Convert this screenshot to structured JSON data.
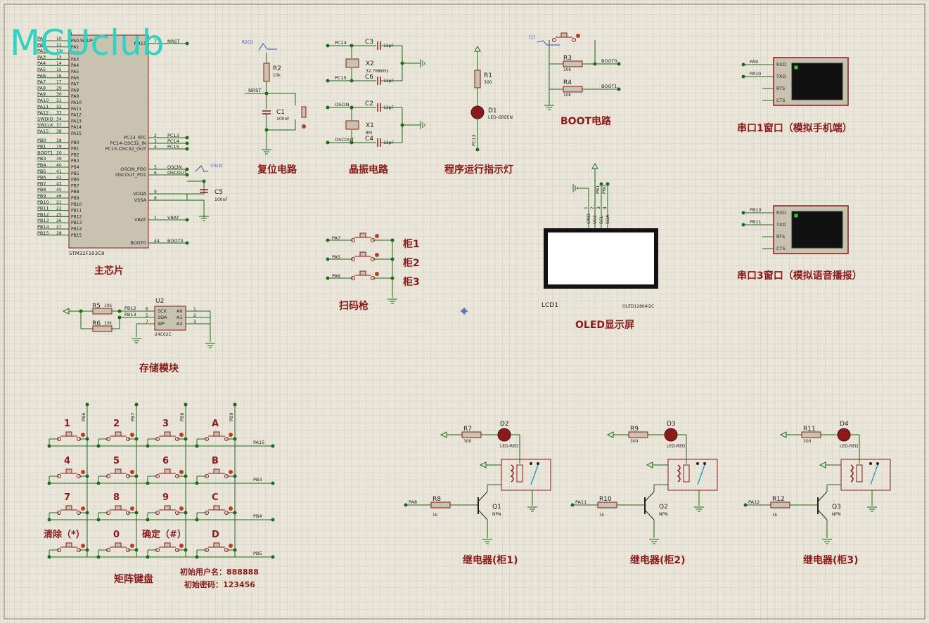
{
  "watermark": "MCUclub",
  "colors": {
    "background": "#e9e6d9",
    "grid": "#d1cdbd",
    "wire": "#1a6b1a",
    "component": "#8b1a1a",
    "chip": "#c8c3b0",
    "label": "#8b1a1a",
    "watermark": "#2ed3c2"
  },
  "mcu": {
    "ref": "U",
    "part": "STM32F103C8",
    "section_label": "主芯片",
    "left_pins": [
      {
        "name": "PA0",
        "num": "10"
      },
      {
        "name": "PA1",
        "num": "11"
      },
      {
        "name": "PA2",
        "num": "12"
      },
      {
        "name": "PA3",
        "num": "13"
      },
      {
        "name": "PA4",
        "num": "14"
      },
      {
        "name": "PA5",
        "num": "15"
      },
      {
        "name": "PA6",
        "num": "16"
      },
      {
        "name": "PA7",
        "num": "17"
      },
      {
        "name": "PA8",
        "num": "29"
      },
      {
        "name": "PA9",
        "num": "30"
      },
      {
        "name": "PA10",
        "num": "31"
      },
      {
        "name": "PA11",
        "num": "32"
      },
      {
        "name": "PA12",
        "num": "33"
      },
      {
        "name": "SWDIO",
        "num": "34"
      },
      {
        "name": "SWCLK",
        "num": "37"
      },
      {
        "name": "PA15",
        "num": "38"
      },
      {
        "name": "PB0",
        "num": "18"
      },
      {
        "name": "PB1",
        "num": "19"
      },
      {
        "name": "BOOT1",
        "num": "20"
      },
      {
        "name": "PB3",
        "num": "39"
      },
      {
        "name": "PB4",
        "num": "40"
      },
      {
        "name": "PB5",
        "num": "41"
      },
      {
        "name": "PB6",
        "num": "42"
      },
      {
        "name": "PB7",
        "num": "43"
      },
      {
        "name": "PB8",
        "num": "45"
      },
      {
        "name": "PB9",
        "num": "46"
      },
      {
        "name": "PB10",
        "num": "21"
      },
      {
        "name": "PB11",
        "num": "22"
      },
      {
        "name": "PB12",
        "num": "25"
      },
      {
        "name": "PB13",
        "num": "26"
      },
      {
        "name": "PB14",
        "num": "27"
      },
      {
        "name": "PB15",
        "num": "28"
      }
    ],
    "inner_left": [
      "PA0-WKUP",
      "PA1",
      "PA2",
      "PA3",
      "PA4",
      "PA5",
      "PA6",
      "PA7",
      "PA8",
      "PA9",
      "PA10",
      "PA11",
      "PA12",
      "PA13",
      "PA14",
      "PA15",
      "PB0",
      "PB1",
      "PB2",
      "PB3",
      "PB4",
      "PB5",
      "PB6",
      "PB7",
      "PB8",
      "PB9",
      "PB10",
      "PB11",
      "PB12",
      "PB13",
      "PB14",
      "PB15"
    ],
    "right_pins": [
      {
        "name": "NRST",
        "num": "7",
        "net": "NRST"
      },
      {
        "name": "PC13_RTC",
        "num": "2",
        "net": "PC13"
      },
      {
        "name": "PC14-OSC32_IN",
        "num": "3",
        "net": "PC14"
      },
      {
        "name": "PC15-OSC32_OUT",
        "num": "4",
        "net": "PC15"
      },
      {
        "name": "OSCIN_PD0",
        "num": "5",
        "net": "OSCIN"
      },
      {
        "name": "OSCOUT_PD1",
        "num": "6",
        "net": "OSCOUT"
      },
      {
        "name": "VDDA",
        "num": "9",
        "net": ""
      },
      {
        "name": "VSSA",
        "num": "8",
        "net": ""
      },
      {
        "name": "VBAT",
        "num": "1",
        "net": "VBAT"
      },
      {
        "name": "BOOT0",
        "num": "44",
        "net": "BOOT0"
      }
    ],
    "cap": {
      "ref": "C5",
      "value": "100nF",
      "probe": "C5(2)"
    }
  },
  "reset": {
    "label": "复位电路",
    "r_ref": "R2",
    "r_val": "10k",
    "c_ref": "C1",
    "c_val": "100nF",
    "net": "NRST",
    "probe": "R2(2)"
  },
  "crystal": {
    "label": "晶振电路",
    "x2": "X2",
    "x2_val": "32.768KHz",
    "x1": "X1",
    "x1_val": "8M",
    "c3": "C3",
    "c6": "C6",
    "c2": "C2",
    "c4": "C4",
    "cap_val": "12pF",
    "nets": [
      "PC14",
      "PC15",
      "OSCIN",
      "OSCOUT"
    ]
  },
  "led_indicator": {
    "label": "程序运行指示灯",
    "r_ref": "R1",
    "r_val": "300",
    "d_ref": "D1",
    "d_val": "LED-GREEN",
    "net": "PC13"
  },
  "boot": {
    "label": "BOOT电路",
    "r3": "R3",
    "r4": "R4",
    "val": "10k",
    "nets": [
      "BOOT0",
      "BOOT1"
    ],
    "probe": "[1]"
  },
  "uart1": {
    "label": "串口1窗口（模拟手机端）",
    "pins": [
      "RXD",
      "TXD",
      "RTS",
      "CTS"
    ],
    "nets": [
      "PA9",
      "PA10"
    ]
  },
  "uart3": {
    "label": "串口3窗口（模拟语音播报）",
    "pins": [
      "RXD",
      "TXD",
      "RTS",
      "CTS"
    ],
    "nets": [
      "PB10",
      "PB11"
    ]
  },
  "oled": {
    "label": "OLED显示屏",
    "ref": "LCD1",
    "part": "OLED12864I2C",
    "pins": [
      "GND",
      "VCC",
      "SCL",
      "SDA"
    ],
    "pin_nums": [
      "1",
      "2",
      "3",
      "4"
    ],
    "nets": [
      "PB1",
      "PB0"
    ]
  },
  "scanner": {
    "label": "扫码枪",
    "buttons": [
      {
        "net": "PA7",
        "label": "柜1"
      },
      {
        "net": "PA5",
        "label": "柜2"
      },
      {
        "net": "PA6",
        "label": "柜3"
      }
    ]
  },
  "eeprom": {
    "label": "存储模块",
    "ref": "U2",
    "part": "24C02C",
    "r5": "R5",
    "r6": "R6",
    "r_val": "10k",
    "nets": [
      "PB12",
      "PB13"
    ],
    "left_pins": [
      {
        "name": "SCK",
        "num": "6"
      },
      {
        "name": "SDA",
        "num": "5"
      },
      {
        "name": "WP",
        "num": "7"
      }
    ],
    "right_pins": [
      {
        "name": "A0",
        "num": "1"
      },
      {
        "name": "A1",
        "num": "2"
      },
      {
        "name": "A2",
        "num": "3"
      }
    ]
  },
  "keypad": {
    "label": "矩阵键盘",
    "cols": [
      "PB6",
      "PB7",
      "PB8",
      "PB9"
    ],
    "rows": [
      "PA15",
      "PB3",
      "PB4",
      "PB5"
    ],
    "keys": [
      [
        "1",
        "2",
        "3",
        "A"
      ],
      [
        "4",
        "5",
        "6",
        "B"
      ],
      [
        "7",
        "8",
        "9",
        "C"
      ],
      [
        "清除（*）",
        "0",
        "确定（#）",
        "D"
      ]
    ],
    "note1": "初始用户名：888888",
    "note2": "初始密码：123456"
  },
  "relays": [
    {
      "label": "继电器(柜1)",
      "r_led": "R7",
      "r_led_val": "300",
      "d": "D2",
      "d_val": "LED-RED",
      "r_b": "R8",
      "r_b_val": "1k",
      "q": "Q1",
      "q_val": "NPN",
      "net": "PA8"
    },
    {
      "label": "继电器(柜2)",
      "r_led": "R9",
      "r_led_val": "300",
      "d": "D3",
      "d_val": "LED-RED",
      "r_b": "R10",
      "r_b_val": "1k",
      "q": "Q2",
      "q_val": "NPN",
      "net": "PA11"
    },
    {
      "label": "继电器(柜3)",
      "r_led": "R11",
      "r_led_val": "300",
      "d": "D4",
      "d_val": "LED-RED",
      "r_b": "R12",
      "r_b_val": "1k",
      "q": "Q3",
      "q_val": "NPN",
      "net": "PA12"
    }
  ]
}
